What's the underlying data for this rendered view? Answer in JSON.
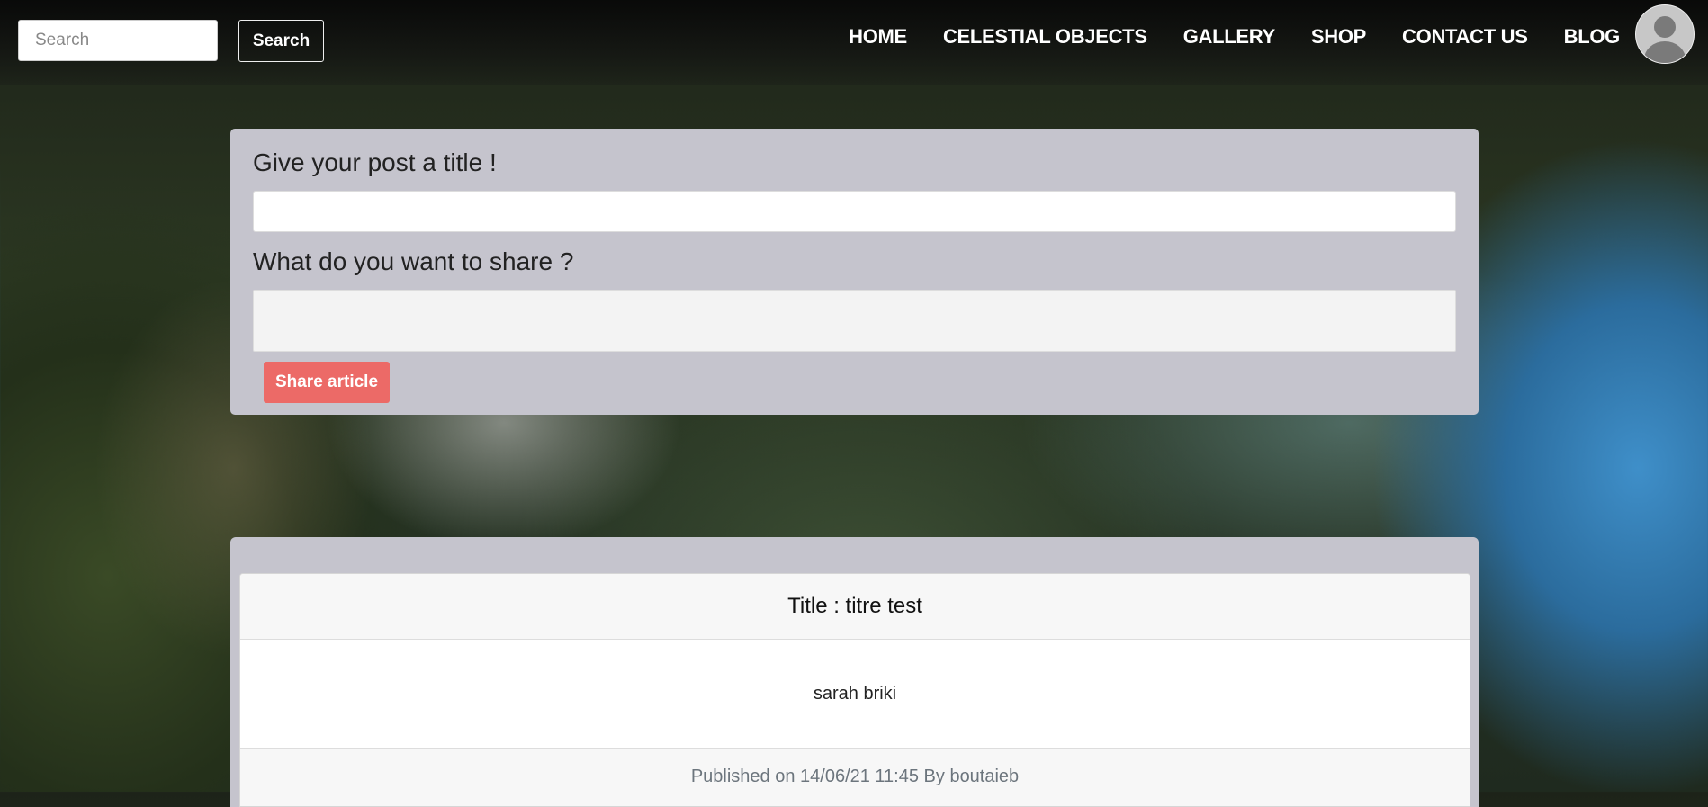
{
  "header": {
    "search": {
      "placeholder": "Search",
      "value": "",
      "button_label": "Search"
    },
    "nav": {
      "items": [
        {
          "label": "HOME"
        },
        {
          "label": "CELESTIAL OBJECTS"
        },
        {
          "label": "GALLERY"
        },
        {
          "label": "SHOP"
        },
        {
          "label": "CONTACT US"
        },
        {
          "label": "BLOG"
        }
      ]
    },
    "avatar_icon": "user-avatar-icon"
  },
  "post_form": {
    "title_label": "Give your post a title !",
    "title_value": "",
    "content_label": "What do you want to share ?",
    "content_value": "",
    "submit_label": "Share article"
  },
  "posts": [
    {
      "title": "Title : titre test",
      "body": "sarah briki",
      "footer": "Published on 14/06/21 11:45 By boutaieb"
    }
  ],
  "colors": {
    "share_button": "#ec6a67",
    "card_background": "#c5c4cd",
    "footer_text": "#6c757d"
  }
}
